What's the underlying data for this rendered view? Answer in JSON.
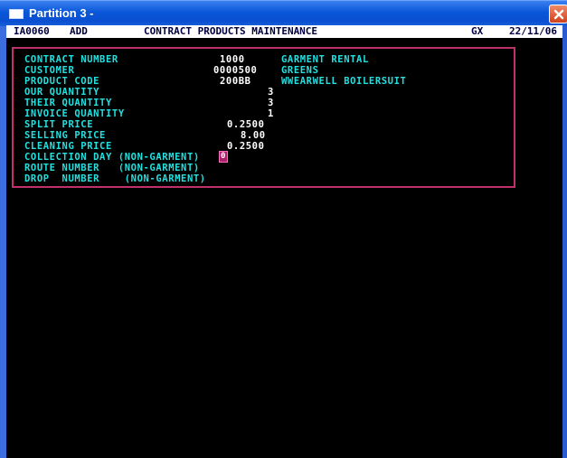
{
  "window": {
    "title": "Partition 3 -"
  },
  "header": {
    "program": "IA0060",
    "mode": "ADD",
    "screen_title": "CONTRACT PRODUCTS MAINTENANCE",
    "company": "GX",
    "date": "22/11/06"
  },
  "fields": {
    "contract_number": {
      "label": "CONTRACT NUMBER",
      "value": "1000",
      "desc": "GARMENT RENTAL"
    },
    "customer": {
      "label": "CUSTOMER",
      "value": "0000500",
      "desc": "GREENS"
    },
    "product_code": {
      "label": "PRODUCT CODE",
      "value": "200BB",
      "desc": "WWEARWELL BOILERSUIT"
    },
    "our_quantity": {
      "label": "OUR QUANTITY",
      "value": "3"
    },
    "their_quantity": {
      "label": "THEIR QUANTITY",
      "value": "3"
    },
    "invoice_quantity": {
      "label": "INVOICE QUANTITY",
      "value": "1"
    },
    "split_price": {
      "label": "SPLIT PRICE",
      "value": "0.2500"
    },
    "selling_price": {
      "label": "SELLING PRICE",
      "value": "8.00"
    },
    "cleaning_price": {
      "label": "CLEANING PRICE",
      "value": "0.2500"
    },
    "collection_day": {
      "label": "COLLECTION DAY (NON-GARMENT)",
      "value": "0"
    },
    "route_number": {
      "label": "ROUTE NUMBER   (NON-GARMENT)"
    },
    "drop_number": {
      "label": "DROP  NUMBER    (NON-GARMENT)"
    }
  },
  "colors": {
    "label": "#22e0e0",
    "value": "#ffffff",
    "panel_border": "#c0306a",
    "cursor": "#b0206a",
    "titlebar": "#0a56d9"
  },
  "icons": {
    "app": "terminal-window-icon",
    "close": "close-icon"
  }
}
